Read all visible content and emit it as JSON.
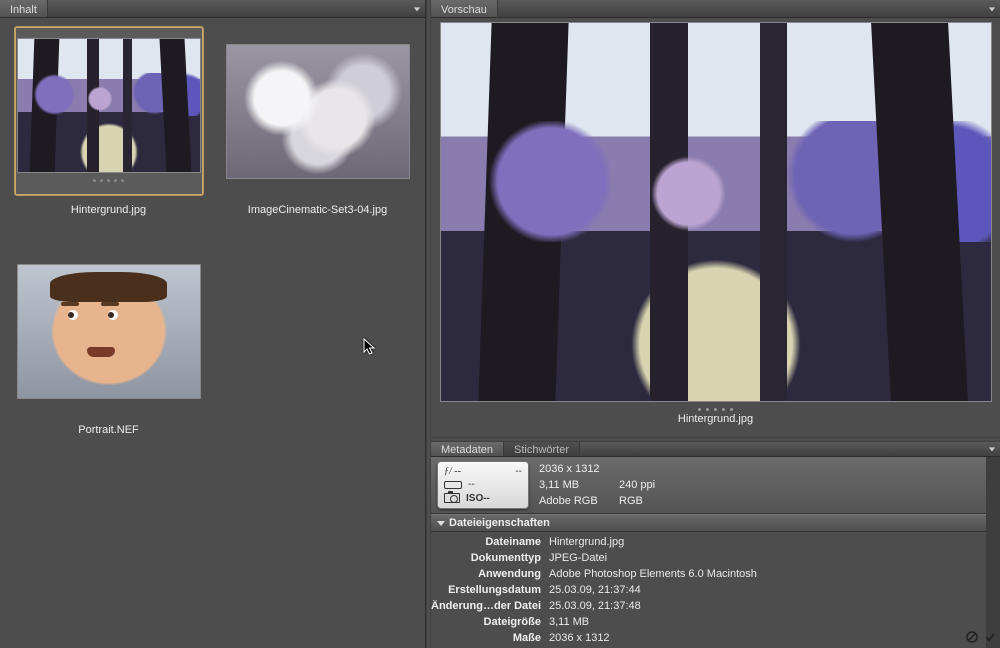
{
  "panels": {
    "content_tab": "Inhalt",
    "preview_tab": "Vorschau",
    "metadata_tab": "Metadaten",
    "keywords_tab": "Stichwörter"
  },
  "thumbnails": [
    {
      "filename": "Hintergrund.jpg",
      "selected": true,
      "kind": "forest"
    },
    {
      "filename": "ImageCinematic-Set3-04.jpg",
      "selected": false,
      "kind": "smoke"
    },
    {
      "filename": "Portrait.NEF",
      "selected": false,
      "kind": "portrait"
    }
  ],
  "preview": {
    "filename": "Hintergrund.jpg"
  },
  "camera_box": {
    "aperture": "ƒ/ --",
    "shutter": "--",
    "meter": "--",
    "iso": "ISO--"
  },
  "summary": {
    "dimensions": "2036 x 1312",
    "filesize": "3,11 MB",
    "resolution": "240 ppi",
    "colorspace": "Adobe RGB",
    "colormode": "RGB"
  },
  "section_header": "Dateieigenschaften",
  "props": [
    {
      "label": "Dateiname",
      "value": "Hintergrund.jpg"
    },
    {
      "label": "Dokumenttyp",
      "value": "JPEG-Datei"
    },
    {
      "label": "Anwendung",
      "value": "Adobe Photoshop Elements 6.0 Macintosh"
    },
    {
      "label": "Erstellungsdatum",
      "value": "25.03.09, 21:37:44"
    },
    {
      "label": "Änderung…der Datei",
      "value": "25.03.09, 21:37:48"
    },
    {
      "label": "Dateigröße",
      "value": "3,11 MB"
    },
    {
      "label": "Maße",
      "value": "2036 x 1312"
    }
  ]
}
